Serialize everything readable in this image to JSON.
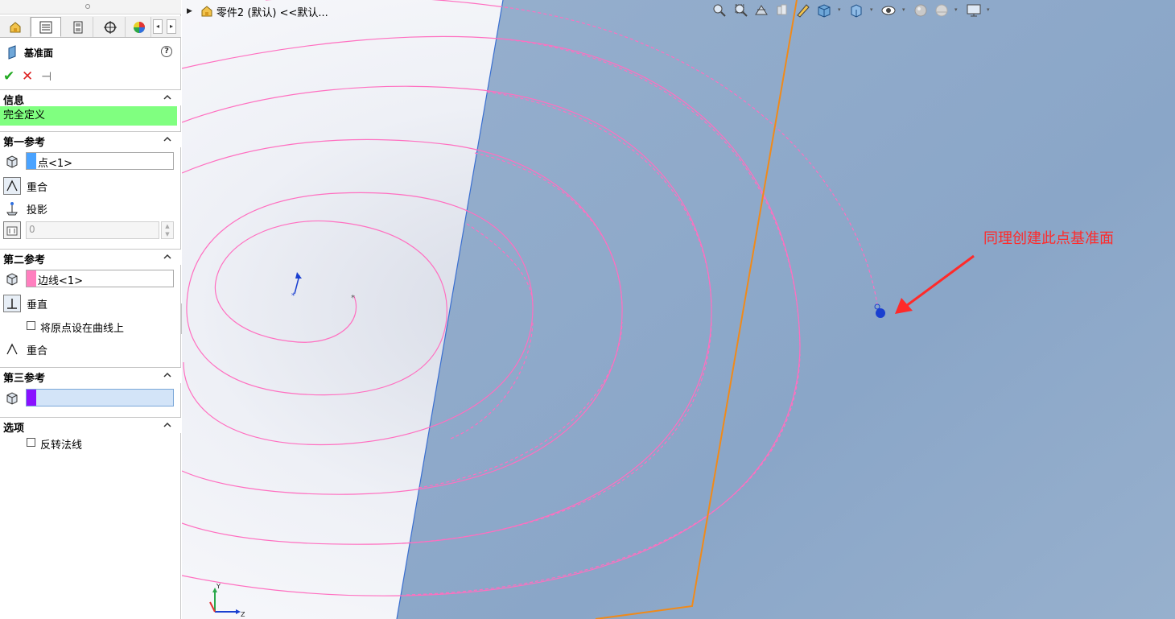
{
  "document": {
    "title": "零件2 (默认) <<默认..."
  },
  "property_manager": {
    "feature_title": "基准面",
    "help": "?",
    "sections": {
      "info": {
        "header": "信息",
        "status": "完全定义"
      },
      "first_ref": {
        "header": "第一参考",
        "selection": "点<1>",
        "swatch": "#4aa3ff",
        "options": [
          "重合",
          "投影"
        ],
        "distance_value": "0"
      },
      "second_ref": {
        "header": "第二参考",
        "selection": "边线<1>",
        "swatch": "#ff7fbf",
        "options": [
          "垂直",
          "重合"
        ],
        "checkbox_label": "将原点设在曲线上"
      },
      "third_ref": {
        "header": "第三参考",
        "selection": "",
        "swatch": "#8a10ff"
      },
      "options": {
        "header": "选项",
        "checkbox_label": "反转法线"
      }
    }
  },
  "viewport": {
    "annotation": "同理创建此点基准面",
    "annotation_color": "#ff2a2a",
    "plane_color": "#8da8c8",
    "spiral_color": "#ff6fc0",
    "edge_color": "#f08a1a",
    "triad_axes": {
      "y": "Y",
      "z": "Z"
    }
  },
  "colors": {
    "status_green": "#80ff80",
    "accent_check": "#22aa22",
    "accent_cross": "#dd2222"
  }
}
